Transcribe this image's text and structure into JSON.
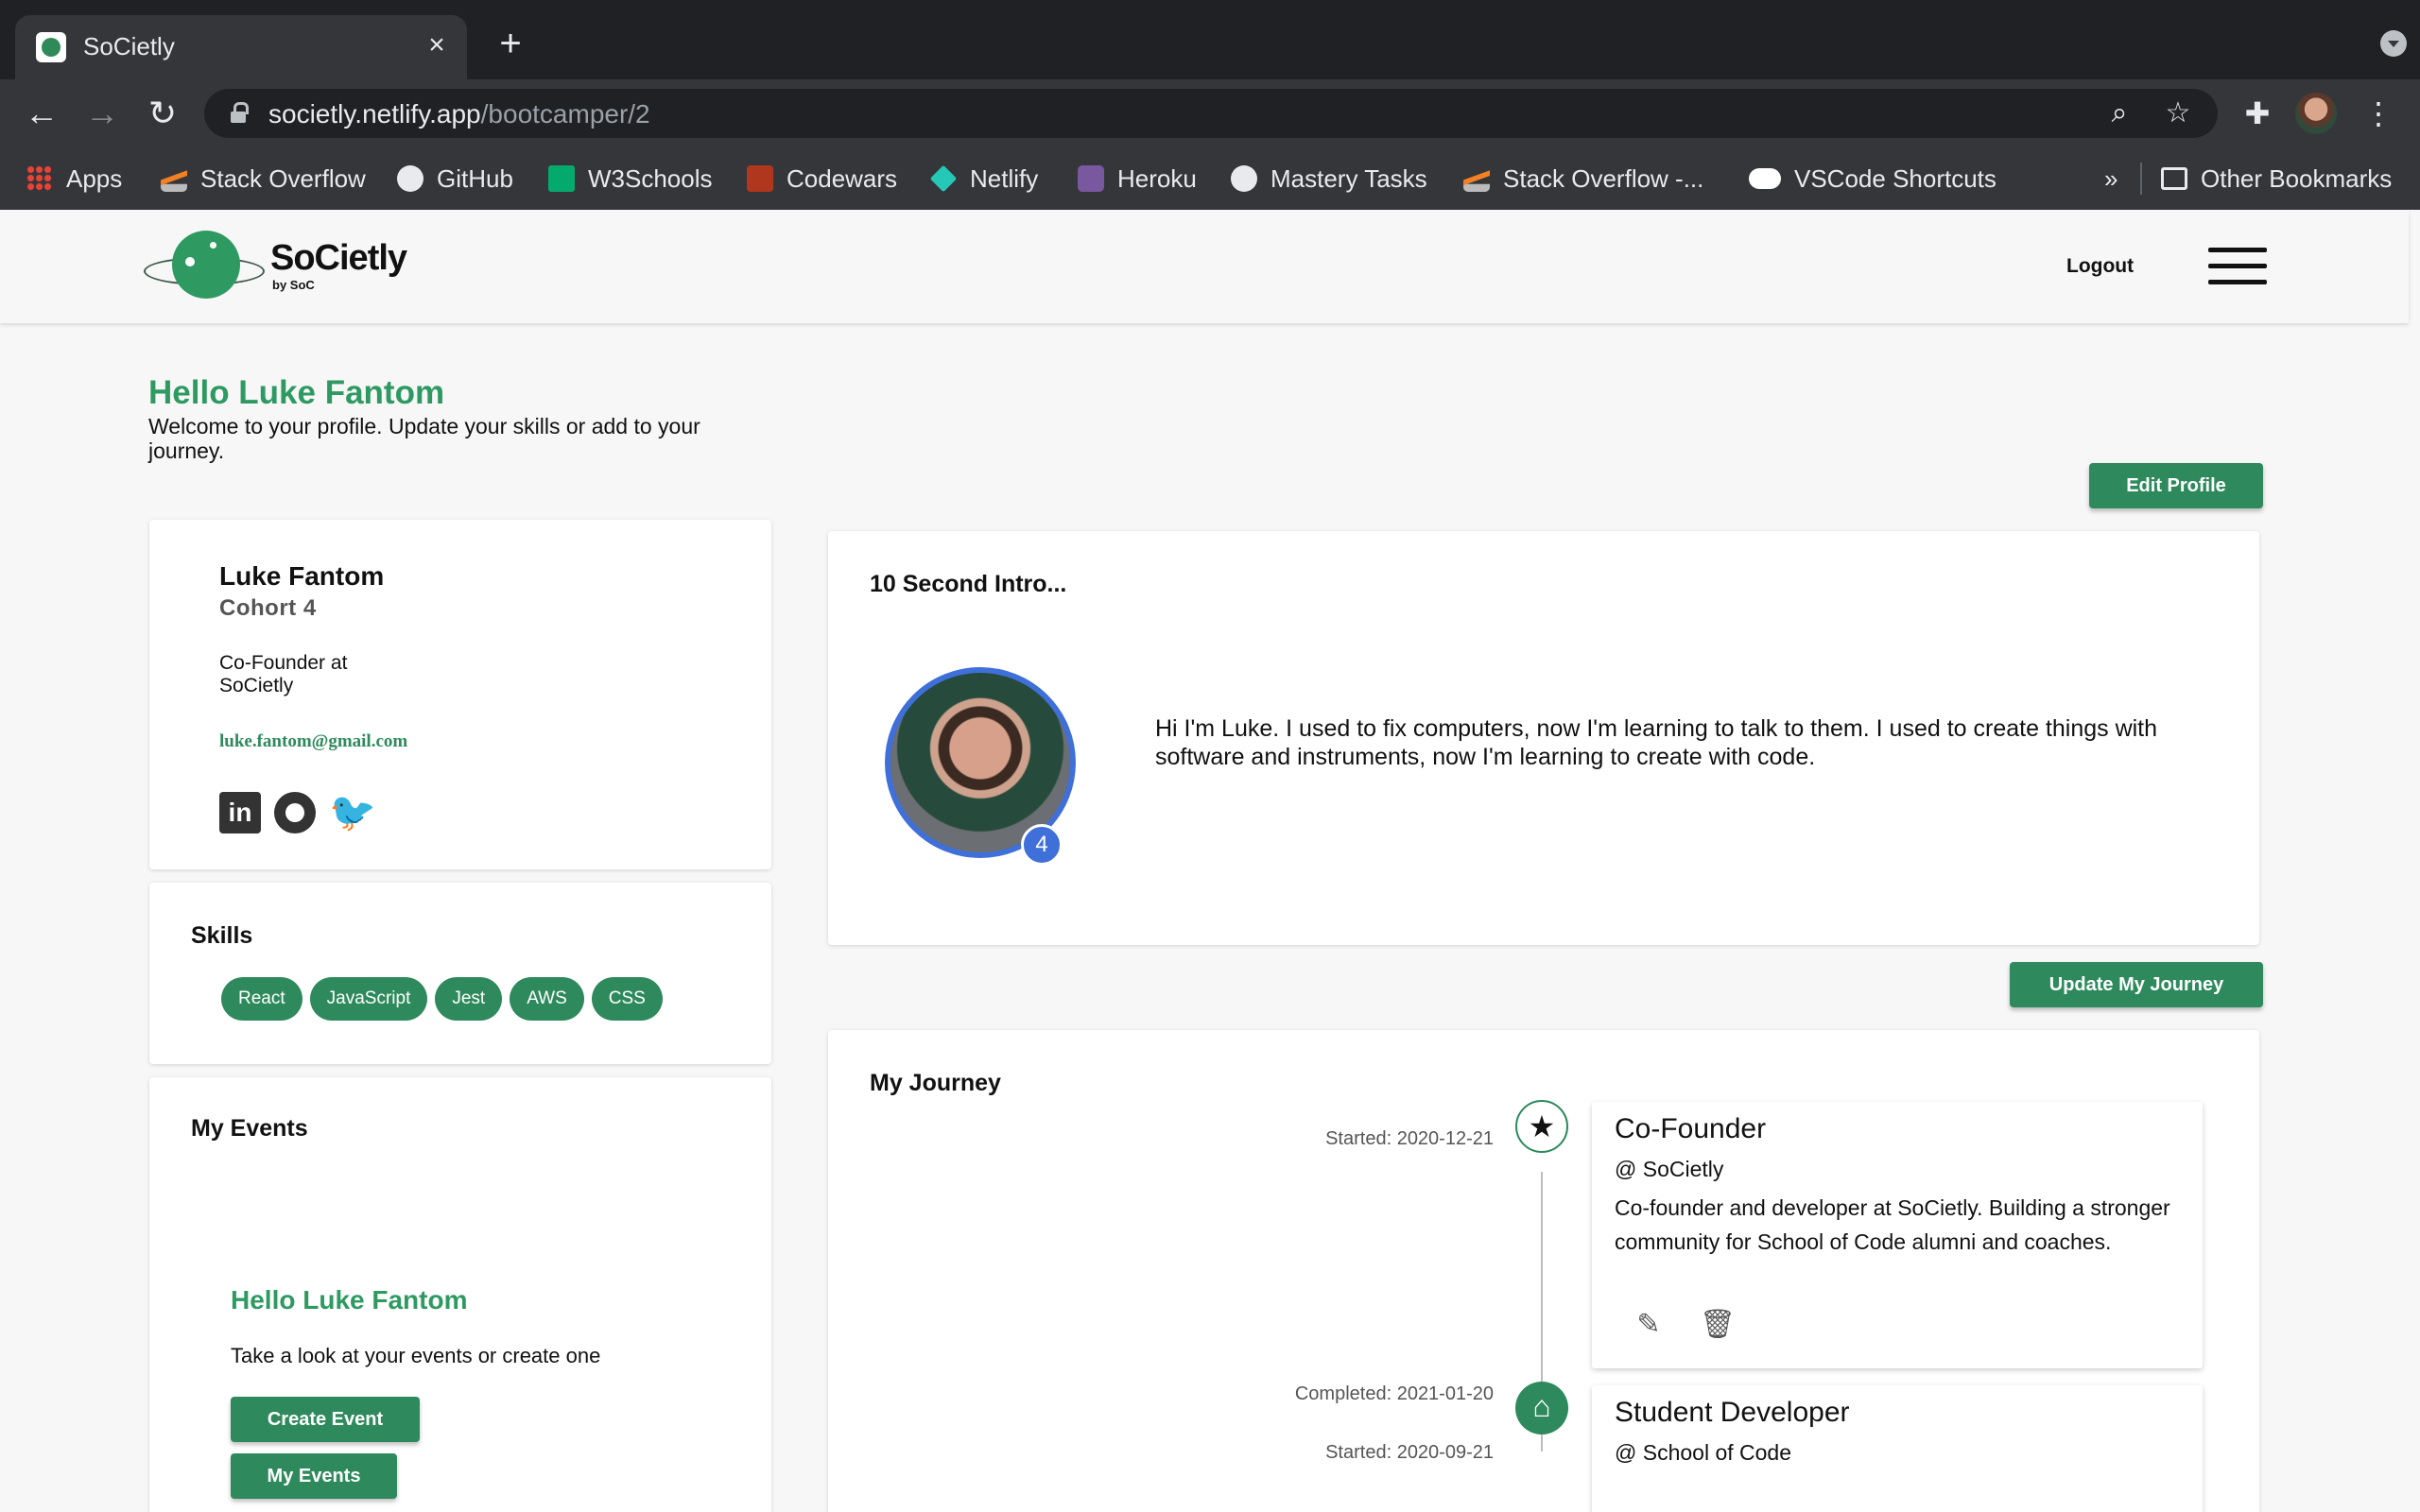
{
  "browser": {
    "tab_title": "SoCietly",
    "url_host": "societly.netlify.app",
    "url_path": "/bootcamper/2",
    "bookmarks": [
      {
        "label": "Apps",
        "icon": "apps-grid-icon"
      },
      {
        "label": "Stack Overflow",
        "icon": "stackoverflow-icon"
      },
      {
        "label": "GitHub",
        "icon": "github-icon"
      },
      {
        "label": "W3Schools",
        "icon": "w3schools-icon"
      },
      {
        "label": "Codewars",
        "icon": "codewars-icon"
      },
      {
        "label": "Netlify",
        "icon": "netlify-icon"
      },
      {
        "label": "Heroku",
        "icon": "heroku-icon"
      },
      {
        "label": "Mastery Tasks",
        "icon": "github-icon"
      },
      {
        "label": "Stack Overflow -...",
        "icon": "stackoverflow-icon"
      },
      {
        "label": "VSCode Shortcuts",
        "icon": "medium-icon"
      }
    ],
    "overflow_label": "»",
    "other_bookmarks": "Other Bookmarks"
  },
  "header": {
    "logo_text": "SoCietly",
    "logo_sub": "by SoC",
    "logout": "Logout"
  },
  "greeting": {
    "title": "Hello Luke Fantom",
    "subtitle": "Welcome to your profile. Update your skills or add to your journey."
  },
  "buttons": {
    "edit_profile": "Edit Profile",
    "update_journey": "Update My Journey",
    "create_event": "Create Event",
    "my_events": "My Events"
  },
  "profile": {
    "name": "Luke Fantom",
    "cohort": "Cohort 4",
    "role": "Co-Founder at SoCietly",
    "email": "luke.fantom@gmail.com",
    "linkedin_glyph": "in",
    "twitter_glyph": "🐦"
  },
  "skills": {
    "heading": "Skills",
    "items": [
      "React",
      "JavaScript",
      "Jest",
      "AWS",
      "CSS"
    ]
  },
  "events": {
    "heading": "My Events",
    "hello": "Hello Luke Fantom",
    "sub": "Take a look at your events or create one"
  },
  "intro": {
    "heading": "10 Second Intro...",
    "badge": "4",
    "text": "Hi I'm Luke. I used to fix computers, now I'm learning to talk to them. I used to create things with software and instruments, now I'm learning to create with code."
  },
  "journey": {
    "heading": "My Journey",
    "entries": [
      {
        "started": "Started: 2020-12-21",
        "icon": "star-icon",
        "glyph": "★",
        "title": "Co-Founder",
        "org": "@ SoCietly",
        "description": "Co-founder and developer at SoCietly. Building a stronger community for School of Code alumni and coaches."
      },
      {
        "completed": "Completed: 2021-01-20",
        "started": "Started: 2020-09-21",
        "icon": "home-icon",
        "glyph": "⌂",
        "title": "Student Developer",
        "org": "@ School of Code"
      }
    ]
  },
  "colors": {
    "brand_green": "#2e8a5c",
    "heading_green": "#2e9a62",
    "avatar_ring": "#3f6fd8"
  }
}
